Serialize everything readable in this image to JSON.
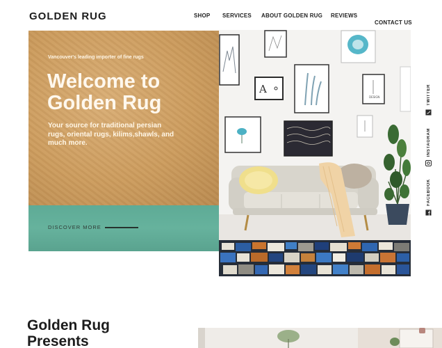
{
  "brand": {
    "name": "GOLDEN RUG"
  },
  "nav": {
    "shop": "SHOP",
    "services": "SERVICES",
    "about": "ABOUT GOLDEN RUG",
    "reviews": "REVIEWS",
    "contact": "CONTACT US"
  },
  "hero": {
    "tagline": "Vancouver's leading importer of fine rugs",
    "title": "Welcome to Golden Rug",
    "subtitle": "Your source for traditional persian rugs, oriental rugs, kilims,shawls, and much more.",
    "cta": "DISCOVER MORE"
  },
  "social": {
    "twitter": "TWITTER",
    "instagram": "INSTAGRAM",
    "facebook": "FACEBOOK"
  },
  "section": {
    "heading": "Golden Rug Presents"
  },
  "art": {
    "frame_caption": "DESIGN"
  },
  "colors": {
    "hero_tan": "#cc9c5e",
    "hero_teal": "#62ad98",
    "text_dark": "#1c1c1c"
  }
}
